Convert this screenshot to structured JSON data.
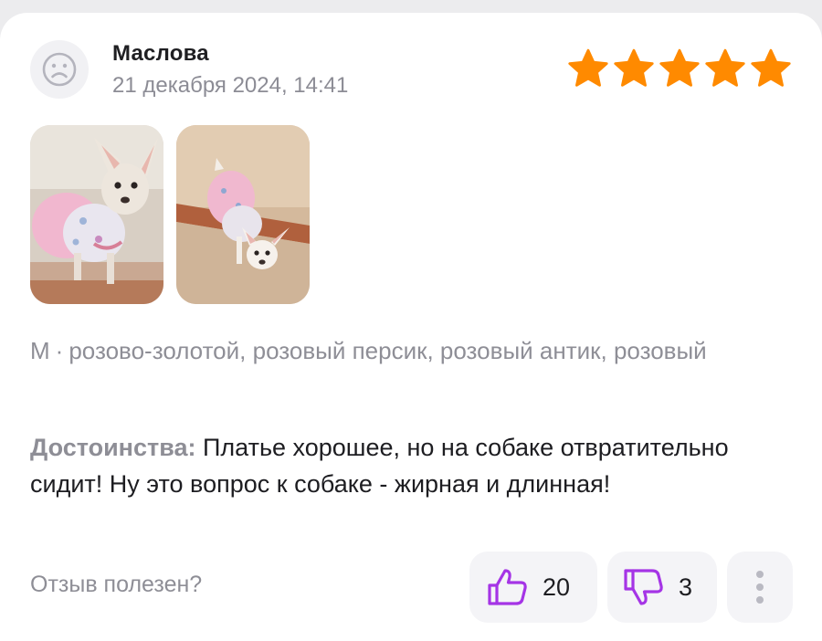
{
  "review": {
    "author": "Маслова",
    "date": "21 декабря 2024, 14:41",
    "rating": 5,
    "rating_max": 5,
    "variant": {
      "size": "M",
      "separator": "·",
      "colors": "розово-золотой, розовый персик, розовый антик, розовый"
    },
    "body": {
      "label": "Достоинства:",
      "text": "Платье хорошее, но на собаке отвратительно сидит! Ну это вопрос к собаке - жирная и длинная!"
    },
    "photos": [
      {
        "name": "review-photo-1"
      },
      {
        "name": "review-photo-2"
      }
    ]
  },
  "feedback": {
    "question": "Отзыв полезен?",
    "likes": "20",
    "dislikes": "3"
  },
  "colors": {
    "star": "#ff8a00",
    "thumb": "#a534e6",
    "muted_text": "#8e8e96",
    "button_bg": "#f4f4f7"
  },
  "icons": {
    "avatar": "user-face-icon",
    "like": "thumbs-up-icon",
    "dislike": "thumbs-down-icon",
    "more": "more-vertical-icon",
    "star": "star-icon"
  }
}
